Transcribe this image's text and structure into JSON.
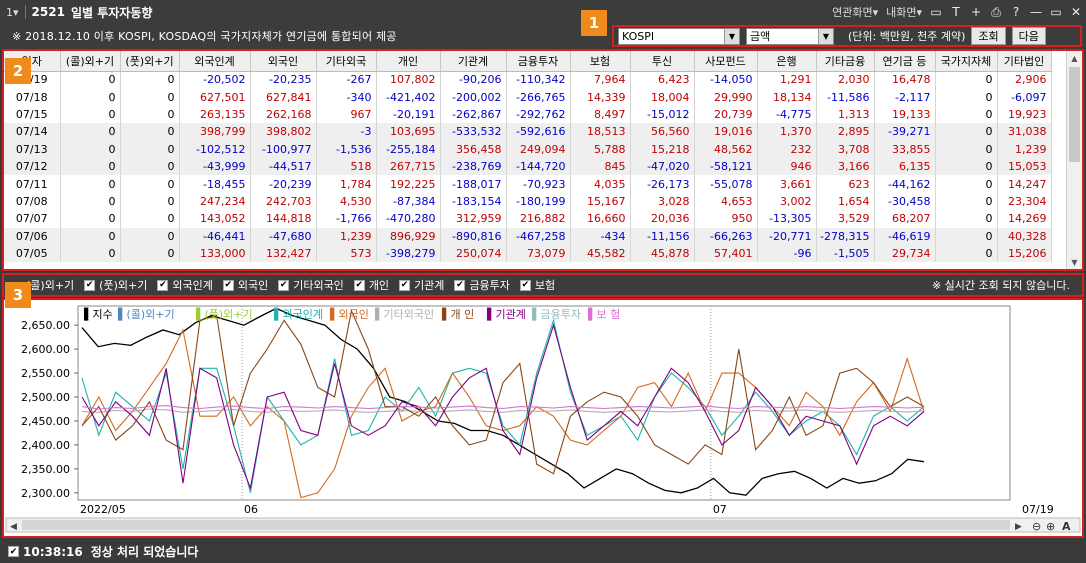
{
  "window": {
    "menu_dropdown": "1▾",
    "screen_no": "2521",
    "screen_name": "일별 투자자동향",
    "linked_screen": "연관화면▾",
    "my_screen": "내화면▾",
    "icons": [
      "screen-icon",
      "text-icon",
      "plus-icon",
      "print-icon",
      "help-icon",
      "minimize-icon",
      "restore-icon",
      "close-icon"
    ]
  },
  "notice": "※ 2018.12.10 이후 KOSPI, KOSDAQ의 국가지자체가 연기금에 통합되어 제공",
  "controls": {
    "market": "KOSPI",
    "mode": "금액",
    "unit": "(단위: 백만원, 천주 계약)",
    "search_button": "조회",
    "next_button": "다음"
  },
  "badges": [
    "1",
    "2",
    "3"
  ],
  "grid": {
    "headers": [
      "일자",
      "(콜)외+기",
      "(풋)외+기",
      "외국인계",
      "외국인",
      "기타외국",
      "개인",
      "기관계",
      "금융투자",
      "보험",
      "투신",
      "사모펀드",
      "은행",
      "기타금융",
      "연기금 등",
      "국가지자체",
      "기타법인"
    ],
    "rows": [
      [
        "07/19",
        "0",
        "0",
        "-20,502",
        "-20,235",
        "-267",
        "107,802",
        "-90,206",
        "-110,342",
        "7,964",
        "6,423",
        "-14,050",
        "1,291",
        "2,030",
        "16,478",
        "0",
        "2,906"
      ],
      [
        "07/18",
        "0",
        "0",
        "627,501",
        "627,841",
        "-340",
        "-421,402",
        "-200,002",
        "-266,765",
        "14,339",
        "18,004",
        "29,990",
        "18,134",
        "-11,586",
        "-2,117",
        "0",
        "-6,097"
      ],
      [
        "07/15",
        "0",
        "0",
        "263,135",
        "262,168",
        "967",
        "-20,191",
        "-262,867",
        "-292,762",
        "8,497",
        "-15,012",
        "20,739",
        "-4,775",
        "1,313",
        "19,133",
        "0",
        "19,923"
      ],
      [
        "07/14",
        "0",
        "0",
        "398,799",
        "398,802",
        "-3",
        "103,695",
        "-533,532",
        "-592,616",
        "18,513",
        "56,560",
        "19,016",
        "1,370",
        "2,895",
        "-39,271",
        "0",
        "31,038"
      ],
      [
        "07/13",
        "0",
        "0",
        "-102,512",
        "-100,977",
        "-1,536",
        "-255,184",
        "356,458",
        "249,094",
        "5,788",
        "15,218",
        "48,562",
        "232",
        "3,708",
        "33,855",
        "0",
        "1,239"
      ],
      [
        "07/12",
        "0",
        "0",
        "-43,999",
        "-44,517",
        "518",
        "267,715",
        "-238,769",
        "-144,720",
        "845",
        "-47,020",
        "-58,121",
        "946",
        "3,166",
        "6,135",
        "0",
        "15,053"
      ],
      [
        "07/11",
        "0",
        "0",
        "-18,455",
        "-20,239",
        "1,784",
        "192,225",
        "-188,017",
        "-70,923",
        "4,035",
        "-26,173",
        "-55,078",
        "3,661",
        "623",
        "-44,162",
        "0",
        "14,247"
      ],
      [
        "07/08",
        "0",
        "0",
        "247,234",
        "242,703",
        "4,530",
        "-87,384",
        "-183,154",
        "-180,199",
        "15,167",
        "3,028",
        "4,653",
        "3,002",
        "1,654",
        "-30,458",
        "0",
        "23,304"
      ],
      [
        "07/07",
        "0",
        "0",
        "143,052",
        "144,818",
        "-1,766",
        "-470,280",
        "312,959",
        "216,882",
        "16,660",
        "20,036",
        "950",
        "-13,305",
        "3,529",
        "68,207",
        "0",
        "14,269"
      ],
      [
        "07/06",
        "0",
        "0",
        "-46,441",
        "-47,680",
        "1,239",
        "896,929",
        "-890,816",
        "-467,258",
        "-434",
        "-11,156",
        "-66,263",
        "-20,771",
        "-278,315",
        "-46,619",
        "0",
        "40,328"
      ],
      [
        "07/05",
        "0",
        "0",
        "133,000",
        "132,427",
        "573",
        "-398,279",
        "250,074",
        "73,079",
        "45,582",
        "45,878",
        "57,401",
        "-96",
        "-1,505",
        "29,734",
        "0",
        "15,206"
      ]
    ]
  },
  "checkboxes": [
    "(콜)외+기",
    "(풋)외+기",
    "외국인계",
    "외국인",
    "기타외국인",
    "개인",
    "기관계",
    "금융투자",
    "보험"
  ],
  "realtime_note": "※ 실시간 조회 되지 않습니다.",
  "chart_data": {
    "type": "line",
    "y_ticks": [
      "2,650.00",
      "2,600.00",
      "2,550.00",
      "2,500.00",
      "2,450.00",
      "2,400.00",
      "2,350.00",
      "2,300.00"
    ],
    "ylim": [
      2285,
      2690
    ],
    "x_labels": [
      "2022/05",
      "06",
      "07",
      "07/19"
    ],
    "legend": [
      {
        "name": "지수",
        "color": "#000000"
      },
      {
        "name": "(콜)외+기",
        "color": "#4f86c6"
      },
      {
        "name": "(풋)외+기",
        "color": "#9acd32"
      },
      {
        "name": "외국인계",
        "color": "#20b2aa"
      },
      {
        "name": "외국인",
        "color": "#d2691e"
      },
      {
        "name": "기타외국인",
        "color": "#b0b0b0"
      },
      {
        "name": "개 인",
        "color": "#8b4513"
      },
      {
        "name": "기관계",
        "color": "#800080"
      },
      {
        "name": "금융투자",
        "color": "#8fbcbc"
      },
      {
        "name": "보 험",
        "color": "#da70d6"
      }
    ],
    "series": [
      {
        "name": "지수",
        "color": "#000000",
        "values": [
          2645,
          2605,
          2612,
          2608,
          2625,
          2640,
          2630,
          2655,
          2670,
          2660,
          2650,
          2668,
          2685,
          2670,
          2660,
          2650,
          2620,
          2600,
          2560,
          2500,
          2490,
          2470,
          2450,
          2445,
          2430,
          2430,
          2420,
          2400,
          2380,
          2360,
          2340,
          2310,
          2330,
          2350,
          2340,
          2320,
          2305,
          2300,
          2310,
          2330,
          2300,
          2295,
          2330,
          2340,
          2345,
          2330,
          2310,
          2330,
          2320,
          2325,
          2340,
          2370,
          2365
        ]
      },
      {
        "name": "외국인계",
        "color": "#20b2aa",
        "values": [
          2540,
          2420,
          2510,
          2480,
          2450,
          2550,
          2350,
          2560,
          2560,
          2440,
          2300,
          2500,
          2450,
          2400,
          2420,
          2580,
          2420,
          2430,
          2500,
          2470,
          2520,
          2460,
          2550,
          2560,
          2550,
          2440,
          2400,
          2550,
          2660,
          2510,
          2420,
          2440,
          2460,
          2410,
          2500,
          2550,
          2520,
          2480,
          2420,
          2460,
          2510,
          2470,
          2420,
          2450,
          2470,
          2440,
          2380,
          2460,
          2480,
          2450,
          2480
        ]
      },
      {
        "name": "외국인",
        "color": "#d2691e",
        "values": [
          2440,
          2500,
          2430,
          2470,
          2520,
          2570,
          2640,
          2460,
          2460,
          2500,
          2440,
          2480,
          2450,
          2290,
          2300,
          2350,
          2460,
          2520,
          2560,
          2450,
          2470,
          2480,
          2550,
          2500,
          2440,
          2430,
          2440,
          2480,
          2460,
          2410,
          2400,
          2430,
          2460,
          2520,
          2530,
          2480,
          2550,
          2470,
          2550,
          2550,
          2520,
          2480,
          2440,
          2510,
          2480,
          2420,
          2490,
          2530,
          2470,
          2580,
          2470
        ]
      },
      {
        "name": "기타외국인",
        "color": "#b0b0b0",
        "values": [
          2470,
          2468,
          2472,
          2470,
          2475,
          2473,
          2468,
          2470,
          2472,
          2474,
          2470,
          2468,
          2472,
          2470,
          2471,
          2473,
          2470,
          2468,
          2470,
          2472,
          2470,
          2469,
          2471,
          2473,
          2470,
          2468,
          2472,
          2470,
          2471,
          2473,
          2470,
          2468,
          2470,
          2472,
          2470,
          2469,
          2471,
          2473,
          2470,
          2468,
          2472,
          2470,
          2471,
          2473,
          2470,
          2468,
          2470,
          2472,
          2470,
          2469,
          2471
        ]
      },
      {
        "name": "개 인",
        "color": "#8b4513",
        "values": [
          2440,
          2480,
          2410,
          2440,
          2490,
          2410,
          2390,
          2660,
          2670,
          2440,
          2550,
          2600,
          2660,
          2610,
          2520,
          2500,
          2680,
          2600,
          2480,
          2480,
          2460,
          2500,
          2440,
          2400,
          2410,
          2530,
          2570,
          2360,
          2340,
          2460,
          2490,
          2510,
          2500,
          2460,
          2400,
          2380,
          2360,
          2400,
          2380,
          2600,
          2390,
          2430,
          2500,
          2420,
          2440,
          2550,
          2560,
          2530,
          2480,
          2500,
          2480
        ]
      },
      {
        "name": "기관계",
        "color": "#800080",
        "values": [
          2500,
          2440,
          2490,
          2460,
          2420,
          2560,
          2320,
          2560,
          2540,
          2400,
          2310,
          2500,
          2510,
          2430,
          2420,
          2570,
          2440,
          2420,
          2440,
          2490,
          2480,
          2440,
          2500,
          2540,
          2560,
          2430,
          2380,
          2540,
          2650,
          2520,
          2410,
          2440,
          2470,
          2440,
          2500,
          2560,
          2530,
          2470,
          2400,
          2430,
          2520,
          2480,
          2420,
          2460,
          2450,
          2440,
          2360,
          2440,
          2460,
          2440,
          2470
        ]
      },
      {
        "name": "보 험",
        "color": "#da70d6",
        "values": [
          2480,
          2475,
          2478,
          2476,
          2480,
          2482,
          2478,
          2476,
          2479,
          2481,
          2478,
          2476,
          2480,
          2479,
          2477,
          2480,
          2478,
          2476,
          2478,
          2480,
          2479,
          2477,
          2479,
          2481,
          2478,
          2476,
          2480,
          2479,
          2477,
          2480,
          2478,
          2476,
          2478,
          2480,
          2479,
          2477,
          2479,
          2481,
          2478,
          2476,
          2480,
          2479,
          2477,
          2480,
          2478,
          2476,
          2478,
          2480,
          2479,
          2477,
          2479
        ]
      }
    ]
  },
  "status": {
    "time": "10:38:16",
    "message": "정상 처리 되었습니다"
  }
}
